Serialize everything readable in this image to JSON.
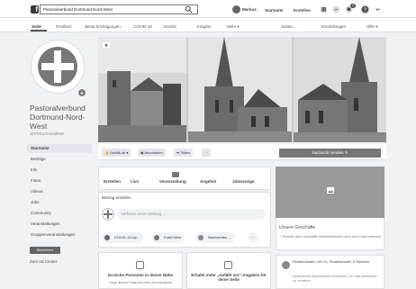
{
  "topbar": {
    "logo": "f",
    "search_value": "Pastoralverbund Dortmund-Nord-West",
    "profile_name": "Markus",
    "nav": [
      "Startseite",
      "Erstellen"
    ],
    "badge_count": "3"
  },
  "tabs": [
    "Seite",
    "Postfach",
    "Benachrichtigungen",
    "COVID-19",
    "Events",
    "Insights",
    "Mehr ▾",
    "Seiten...",
    "Einstellungen",
    "Hilfe ▾"
  ],
  "left": {
    "page_name": "Pastoralverbund Dortmund-Nord-West",
    "handle": "@PVDortmundNW",
    "nav_items": [
      "Startseite",
      "Beiträge",
      "Info",
      "Fotos",
      "Videos",
      "Jobs",
      "Community",
      "Veranstaltungen",
      "Gruppenveranstaltungen"
    ],
    "create_button": "Bewerben",
    "support_link": "Zum Ad Center"
  },
  "actionbar": {
    "liked": "Gefällt dir ▾",
    "follow": "Abonnieren",
    "share": "Teilen",
    "more": "···",
    "send_message": "Nachricht senden ✎"
  },
  "composer": {
    "tabs": [
      "Erstellen",
      "Live",
      "Veranstaltung",
      "Angebot",
      "Jobanzeige"
    ],
    "title": "Beitrag erstellen",
    "placeholder": "Verfasse einen Beitrag ...",
    "chips": [
      "COVID-19-Up...",
      "Foto/Video",
      "Nachrichten ..."
    ],
    "chips_more": "···"
  },
  "cards": [
    {
      "title": "Erreiche Personen in deiner Nähe",
      "sub": "Lege deinen Standort fest und bewerbe"
    },
    {
      "title": "Erhalte mehr „Gefällt mir“-Angaben für deine Seite",
      "sub": ""
    }
  ],
  "right": {
    "shop_title": "Unsere Geschäfte",
    "shop_desc": "+ Erstelle dein Geschäft Geschäftsseite Über den Unternehmen",
    "response_text": "Reaktionsrate: 100 %, Reaktionszeit: 9 Stunden",
    "response_sub": "Beantworte Nachrichten schneller, um das Abzeichen zu erhalten"
  },
  "colors": {
    "bar": "#ffffff",
    "background": "#f0f2f5",
    "accent": "#777777"
  }
}
